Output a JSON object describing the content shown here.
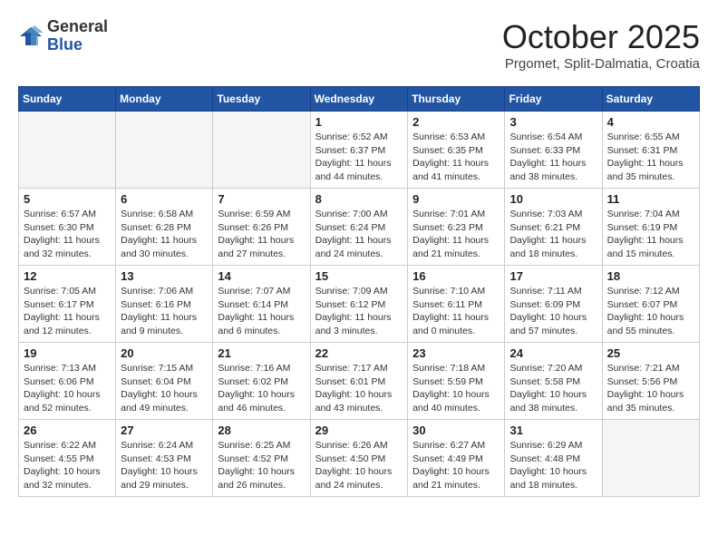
{
  "header": {
    "logo": {
      "general": "General",
      "blue": "Blue"
    },
    "title": "October 2025",
    "location": "Prgomet, Split-Dalmatia, Croatia"
  },
  "days_of_week": [
    "Sunday",
    "Monday",
    "Tuesday",
    "Wednesday",
    "Thursday",
    "Friday",
    "Saturday"
  ],
  "weeks": [
    [
      {
        "num": "",
        "info": ""
      },
      {
        "num": "",
        "info": ""
      },
      {
        "num": "",
        "info": ""
      },
      {
        "num": "1",
        "info": "Sunrise: 6:52 AM\nSunset: 6:37 PM\nDaylight: 11 hours and 44 minutes."
      },
      {
        "num": "2",
        "info": "Sunrise: 6:53 AM\nSunset: 6:35 PM\nDaylight: 11 hours and 41 minutes."
      },
      {
        "num": "3",
        "info": "Sunrise: 6:54 AM\nSunset: 6:33 PM\nDaylight: 11 hours and 38 minutes."
      },
      {
        "num": "4",
        "info": "Sunrise: 6:55 AM\nSunset: 6:31 PM\nDaylight: 11 hours and 35 minutes."
      }
    ],
    [
      {
        "num": "5",
        "info": "Sunrise: 6:57 AM\nSunset: 6:30 PM\nDaylight: 11 hours and 32 minutes."
      },
      {
        "num": "6",
        "info": "Sunrise: 6:58 AM\nSunset: 6:28 PM\nDaylight: 11 hours and 30 minutes."
      },
      {
        "num": "7",
        "info": "Sunrise: 6:59 AM\nSunset: 6:26 PM\nDaylight: 11 hours and 27 minutes."
      },
      {
        "num": "8",
        "info": "Sunrise: 7:00 AM\nSunset: 6:24 PM\nDaylight: 11 hours and 24 minutes."
      },
      {
        "num": "9",
        "info": "Sunrise: 7:01 AM\nSunset: 6:23 PM\nDaylight: 11 hours and 21 minutes."
      },
      {
        "num": "10",
        "info": "Sunrise: 7:03 AM\nSunset: 6:21 PM\nDaylight: 11 hours and 18 minutes."
      },
      {
        "num": "11",
        "info": "Sunrise: 7:04 AM\nSunset: 6:19 PM\nDaylight: 11 hours and 15 minutes."
      }
    ],
    [
      {
        "num": "12",
        "info": "Sunrise: 7:05 AM\nSunset: 6:17 PM\nDaylight: 11 hours and 12 minutes."
      },
      {
        "num": "13",
        "info": "Sunrise: 7:06 AM\nSunset: 6:16 PM\nDaylight: 11 hours and 9 minutes."
      },
      {
        "num": "14",
        "info": "Sunrise: 7:07 AM\nSunset: 6:14 PM\nDaylight: 11 hours and 6 minutes."
      },
      {
        "num": "15",
        "info": "Sunrise: 7:09 AM\nSunset: 6:12 PM\nDaylight: 11 hours and 3 minutes."
      },
      {
        "num": "16",
        "info": "Sunrise: 7:10 AM\nSunset: 6:11 PM\nDaylight: 11 hours and 0 minutes."
      },
      {
        "num": "17",
        "info": "Sunrise: 7:11 AM\nSunset: 6:09 PM\nDaylight: 10 hours and 57 minutes."
      },
      {
        "num": "18",
        "info": "Sunrise: 7:12 AM\nSunset: 6:07 PM\nDaylight: 10 hours and 55 minutes."
      }
    ],
    [
      {
        "num": "19",
        "info": "Sunrise: 7:13 AM\nSunset: 6:06 PM\nDaylight: 10 hours and 52 minutes."
      },
      {
        "num": "20",
        "info": "Sunrise: 7:15 AM\nSunset: 6:04 PM\nDaylight: 10 hours and 49 minutes."
      },
      {
        "num": "21",
        "info": "Sunrise: 7:16 AM\nSunset: 6:02 PM\nDaylight: 10 hours and 46 minutes."
      },
      {
        "num": "22",
        "info": "Sunrise: 7:17 AM\nSunset: 6:01 PM\nDaylight: 10 hours and 43 minutes."
      },
      {
        "num": "23",
        "info": "Sunrise: 7:18 AM\nSunset: 5:59 PM\nDaylight: 10 hours and 40 minutes."
      },
      {
        "num": "24",
        "info": "Sunrise: 7:20 AM\nSunset: 5:58 PM\nDaylight: 10 hours and 38 minutes."
      },
      {
        "num": "25",
        "info": "Sunrise: 7:21 AM\nSunset: 5:56 PM\nDaylight: 10 hours and 35 minutes."
      }
    ],
    [
      {
        "num": "26",
        "info": "Sunrise: 6:22 AM\nSunset: 4:55 PM\nDaylight: 10 hours and 32 minutes."
      },
      {
        "num": "27",
        "info": "Sunrise: 6:24 AM\nSunset: 4:53 PM\nDaylight: 10 hours and 29 minutes."
      },
      {
        "num": "28",
        "info": "Sunrise: 6:25 AM\nSunset: 4:52 PM\nDaylight: 10 hours and 26 minutes."
      },
      {
        "num": "29",
        "info": "Sunrise: 6:26 AM\nSunset: 4:50 PM\nDaylight: 10 hours and 24 minutes."
      },
      {
        "num": "30",
        "info": "Sunrise: 6:27 AM\nSunset: 4:49 PM\nDaylight: 10 hours and 21 minutes."
      },
      {
        "num": "31",
        "info": "Sunrise: 6:29 AM\nSunset: 4:48 PM\nDaylight: 10 hours and 18 minutes."
      },
      {
        "num": "",
        "info": ""
      }
    ]
  ]
}
